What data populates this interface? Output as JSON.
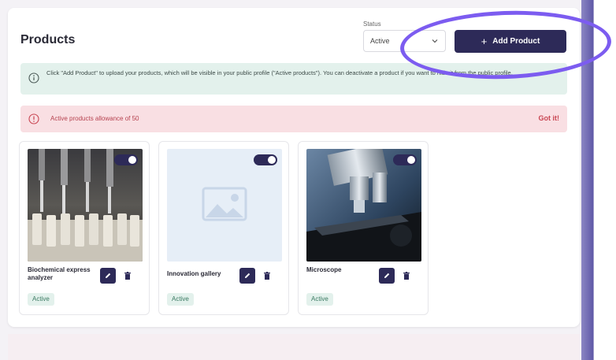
{
  "header": {
    "title": "Products",
    "status_label": "Status",
    "status_value": "Active",
    "add_button_label": "Add Product"
  },
  "info_banner": {
    "text": "Click \"Add Product\" to upload your products, which will be visible in your public profile (\"Active products\"). You can deactivate a product if you want to hide it from the public profile."
  },
  "alert_banner": {
    "text": "Active products allowance of 50",
    "action": "Got it!"
  },
  "products": [
    {
      "name": "Biochemical express analyzer",
      "status": "Active",
      "toggle_on": true,
      "image": "lab-pipettes-photo"
    },
    {
      "name": "Innovation gallery",
      "status": "Active",
      "toggle_on": true,
      "image": "image-placeholder-icon"
    },
    {
      "name": "Microscope",
      "status": "Active",
      "toggle_on": true,
      "image": "microscope-photo"
    }
  ],
  "colors": {
    "primary": "#2d2a58",
    "highlight": "#7c5cf0",
    "info_bg": "#e3f1ec",
    "alert_bg": "#f9dfe3",
    "alert_text": "#c94653"
  }
}
